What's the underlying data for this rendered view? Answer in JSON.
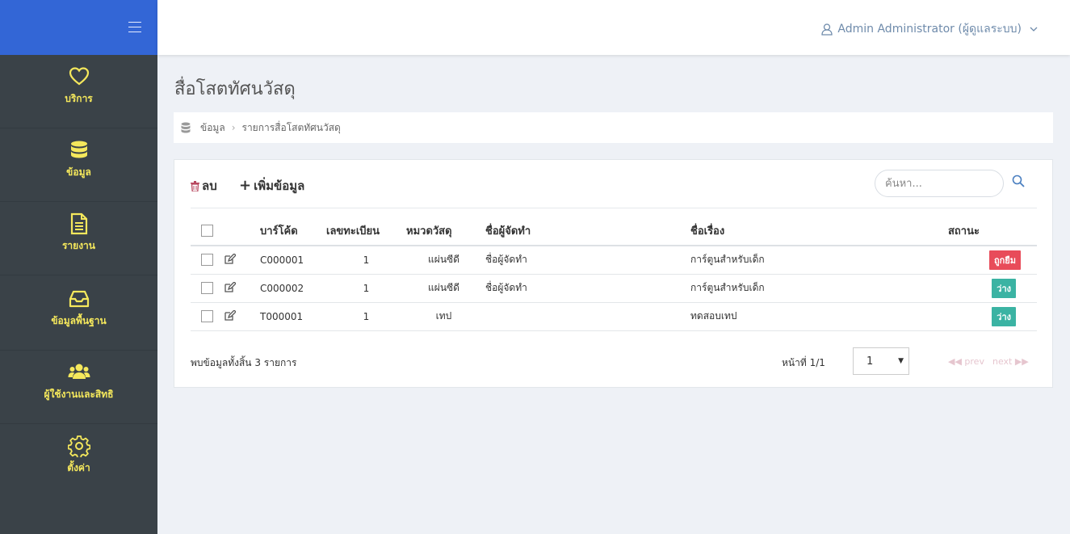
{
  "header": {
    "user_label": "Admin Administrator (ผู้ดูแลระบบ)"
  },
  "sidebar": {
    "items": [
      {
        "label": "บริการ",
        "icon": "heart-icon"
      },
      {
        "label": "ข้อมูล",
        "icon": "database-icon"
      },
      {
        "label": "รายงาน",
        "icon": "document-icon"
      },
      {
        "label": "ข้อมูลพื้นฐาน",
        "icon": "inbox-icon"
      },
      {
        "label": "ผู้ใช้งานและสิทธิ",
        "icon": "users-icon"
      },
      {
        "label": "ตั้งค่า",
        "icon": "gear-icon"
      }
    ]
  },
  "page": {
    "title": "สื่อโสตทัศนวัสดุ"
  },
  "breadcrumb": {
    "root": "ข้อมูล",
    "current": "รายการสื่อโสตทัศนวัสดุ"
  },
  "toolbar": {
    "delete_label": "ลบ",
    "add_label": "เพิ่มข้อมูล"
  },
  "search": {
    "placeholder": "ค้นหา..."
  },
  "table": {
    "columns": [
      "บาร์โค้ด",
      "เลขทะเบียน",
      "หมวดวัสดุ",
      "ชื่อผู้จัดทำ",
      "ชื่อเรื่อง",
      "สถานะ"
    ],
    "rows": [
      {
        "barcode": "C000001",
        "reg_no": "1",
        "category": "แผ่นซีดี",
        "producer": "ชื่อผู้จัดทำ",
        "title": "การ์ตูนสำหรับเด็ก",
        "status": "ถูกยืม",
        "status_color": "#e84c5a"
      },
      {
        "barcode": "C000002",
        "reg_no": "1",
        "category": "แผ่นซีดี",
        "producer": "ชื่อผู้จัดทำ",
        "title": "การ์ตูนสำหรับเด็ก",
        "status": "ว่าง",
        "status_color": "#3bb3a3"
      },
      {
        "barcode": "T000001",
        "reg_no": "1",
        "category": "เทป",
        "producer": "",
        "title": "ทดสอบเทป",
        "status": "ว่าง",
        "status_color": "#3bb3a3"
      }
    ]
  },
  "footer": {
    "summary": "พบข้อมูลทั้งสิ้น 3 รายการ",
    "page_label": "หน้าที่ 1/1",
    "page_value": "1",
    "prev_label": "prev",
    "next_label": "next"
  },
  "colors": {
    "sidebar_top": "#3366d6",
    "sidebar_bg": "#3a4248",
    "nav_accent": "#f5e85c",
    "user_menu": "#6f8bab"
  }
}
